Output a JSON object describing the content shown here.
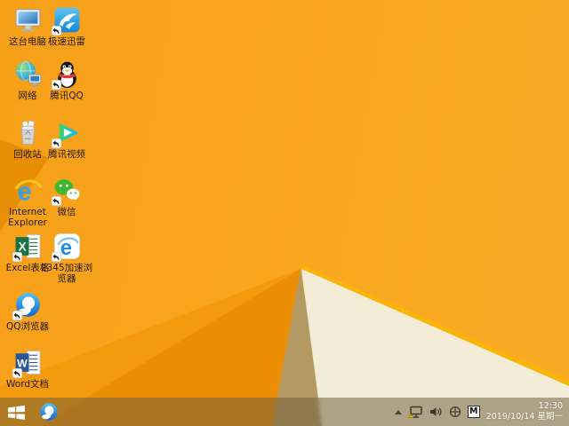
{
  "desktop": {
    "colors": {
      "wallpaper_main": "#f9a71f",
      "wallpaper_topleft_fold": "#e88d06",
      "wallpaper_mid_wedge": "#f39a0e",
      "wallpaper_dark_wedge": "#eb8e06",
      "wallpaper_tan_triangle": "#b49a62",
      "wallpaper_cream_triangle": "#f3edd8",
      "wallpaper_highlight_edge": "#fbb40a",
      "taskbar_tint": "#70603e",
      "label_text": "#241403"
    },
    "icons": [
      {
        "key": "this-pc",
        "label": "这台电脑",
        "col": 0,
        "row": 0,
        "shortcut": false
      },
      {
        "key": "xunlei",
        "label": "极速迅雷",
        "col": 1,
        "row": 0,
        "shortcut": true
      },
      {
        "key": "network",
        "label": "网络",
        "col": 0,
        "row": 1,
        "shortcut": false
      },
      {
        "key": "qq",
        "label": "腾讯QQ",
        "col": 1,
        "row": 1,
        "shortcut": true
      },
      {
        "key": "recycle-bin",
        "label": "回收站",
        "col": 0,
        "row": 2,
        "shortcut": false
      },
      {
        "key": "tencent-video",
        "label": "腾讯视频",
        "col": 1,
        "row": 2,
        "shortcut": true
      },
      {
        "key": "internet-explorer",
        "label": "Internet Explorer",
        "col": 0,
        "row": 3,
        "shortcut": false
      },
      {
        "key": "wechat",
        "label": "微信",
        "col": 1,
        "row": 3,
        "shortcut": true
      },
      {
        "key": "excel",
        "label": "Excel表格",
        "col": 0,
        "row": 4,
        "shortcut": true
      },
      {
        "key": "browser-2345",
        "label": "2345加速浏览器",
        "col": 1,
        "row": 4,
        "shortcut": true
      },
      {
        "key": "qq-browser",
        "label": "QQ浏览器",
        "col": 0,
        "row": 5,
        "shortcut": true
      },
      {
        "key": "word",
        "label": "Word文档",
        "col": 0,
        "row": 6,
        "shortcut": true
      }
    ]
  },
  "taskbar": {
    "pinned": [
      {
        "key": "qq-browser",
        "name": "qq-browser-taskbar-icon"
      }
    ],
    "tray": {
      "icons": [
        {
          "key": "show-hidden-icons-arrow"
        },
        {
          "key": "network-warning"
        },
        {
          "key": "volume"
        },
        {
          "key": "safely-remove-hardware"
        },
        {
          "key": "input-method-indicator"
        }
      ],
      "input_indicator": "M",
      "clock_time": "12:30",
      "clock_date": "2019/10/14 星期一"
    }
  }
}
